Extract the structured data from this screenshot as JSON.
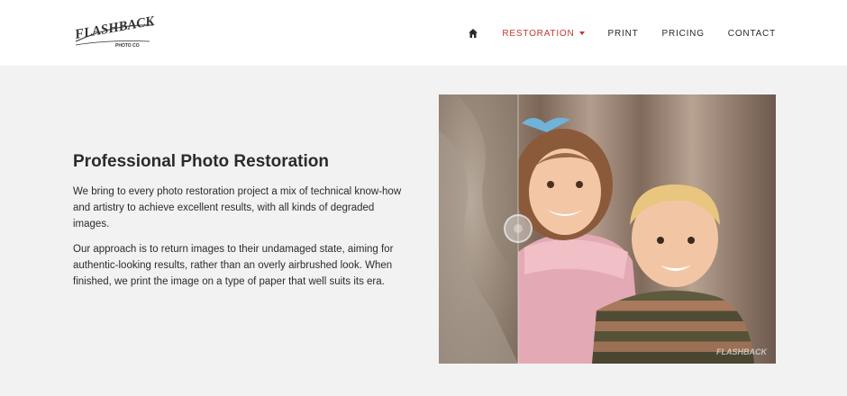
{
  "brand": {
    "logo_main": "FLASHBACK",
    "logo_sub": "PHOTO CO"
  },
  "nav": {
    "home_icon": "home-icon",
    "items": [
      {
        "label": "RESTORATION",
        "active": true,
        "has_dropdown": true
      },
      {
        "label": "PRINT"
      },
      {
        "label": "PRICING"
      },
      {
        "label": "CONTACT"
      }
    ]
  },
  "hero": {
    "title": "Professional Photo Restoration",
    "paragraphs": [
      "We bring to every photo restoration project a mix of technical know-how and artistry to achieve excellent results, with all kinds of degraded images.",
      "Our approach is to return images to their undamaged state, aiming for authentic-looking results, rather than an overly airbrushed look. When finished, we print the image on a type of paper that well suits its era."
    ],
    "image": {
      "watermark": "FLASHBACK",
      "slider_position_pct": 23
    }
  },
  "colors": {
    "accent": "#c0392b",
    "header_bg": "#ffffff",
    "page_bg": "#f2f2f2",
    "text": "#2b2b2b"
  }
}
